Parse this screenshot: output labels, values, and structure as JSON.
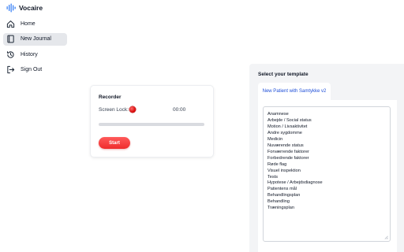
{
  "app": {
    "name": "Vocaire",
    "logo_icon": "waveform-icon",
    "accent_color": "#3b82f6"
  },
  "sidebar": {
    "items": [
      {
        "label": "Home",
        "icon": "home-icon",
        "active": false
      },
      {
        "label": "New Journal",
        "icon": "book-icon",
        "active": true
      },
      {
        "label": "History",
        "icon": "history-icon",
        "active": false
      },
      {
        "label": "Sign Out",
        "icon": "sign-out-icon",
        "active": false
      }
    ]
  },
  "recorder": {
    "title": "Recorder",
    "screen_lock_label": "Screen Lock:",
    "screen_lock_status_color": "#e11d1d",
    "time": "00:00",
    "progress": 0,
    "start_label": "Start",
    "start_color": "#ef4444"
  },
  "template": {
    "heading": "Select your template",
    "selected_tab": "New Patient with Samtykke v2",
    "content_lines": [
      "Anamnese",
      "Arbejde / Social status",
      "Motion / Livsaktivitet",
      "Andre sygdomme",
      "Medicin",
      "Nuværende status",
      "Forværrende faktorer",
      "Forbedrende faktorer",
      "Røde flag",
      "Visuel inspektion",
      "Tests",
      "Hypotese / Arbejdsdiagnose",
      "Patientens mål",
      "Behandlingsplan",
      "Behandling",
      "Træningsplan"
    ]
  }
}
